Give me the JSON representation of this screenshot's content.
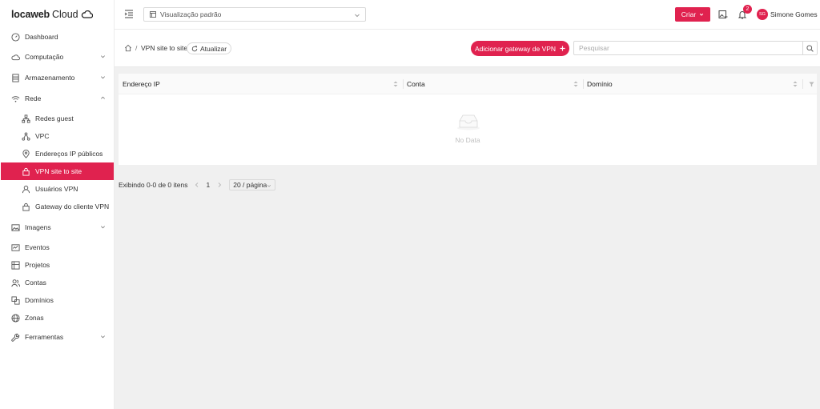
{
  "brand": {
    "name_bold": "locaweb",
    "name_regular": "Cloud"
  },
  "topbar": {
    "view_select": "Visualização padrão",
    "criar_label": "Criar",
    "notification_count": "2",
    "user_initials": "SG",
    "user_name": "Simone Gomes"
  },
  "sidebar": {
    "items": [
      {
        "label": "Dashboard",
        "icon": "dashboard-icon"
      },
      {
        "label": "Computação",
        "icon": "cloud-icon"
      },
      {
        "label": "Armazenamento",
        "icon": "storage-icon"
      },
      {
        "label": "Rede",
        "icon": "wifi-icon"
      },
      {
        "label": "Redes guest",
        "icon": "network-icon"
      },
      {
        "label": "VPC",
        "icon": "vpc-icon"
      },
      {
        "label": "Endereços IP públicos",
        "icon": "location-icon"
      },
      {
        "label": "VPN site to site",
        "icon": "lock-icon"
      },
      {
        "label": "Usuários VPN",
        "icon": "user-icon"
      },
      {
        "label": "Gateway do cliente VPN",
        "icon": "lock-icon"
      },
      {
        "label": "Imagens",
        "icon": "image-icon"
      },
      {
        "label": "Eventos",
        "icon": "events-icon"
      },
      {
        "label": "Projetos",
        "icon": "projects-icon"
      },
      {
        "label": "Contas",
        "icon": "users-icon"
      },
      {
        "label": "Domínios",
        "icon": "domains-icon"
      },
      {
        "label": "Zonas",
        "icon": "globe-icon"
      },
      {
        "label": "Ferramentas",
        "icon": "wrench-icon"
      }
    ],
    "active": "VPN site to site"
  },
  "breadcrumb": {
    "current": "VPN site to site",
    "refresh_label": "Atualizar"
  },
  "actions": {
    "add_gateway_label": "Adicionar gateway de VPN",
    "search_placeholder": "Pesquisar"
  },
  "table": {
    "columns": [
      "Endereço IP",
      "Conta",
      "Domínio"
    ],
    "empty_text": "No Data"
  },
  "pagination": {
    "total_text": "Exibindo 0-0 de 0 itens",
    "current_page": "1",
    "page_size": "20 / página"
  },
  "colors": {
    "accent": "#e0224f"
  }
}
